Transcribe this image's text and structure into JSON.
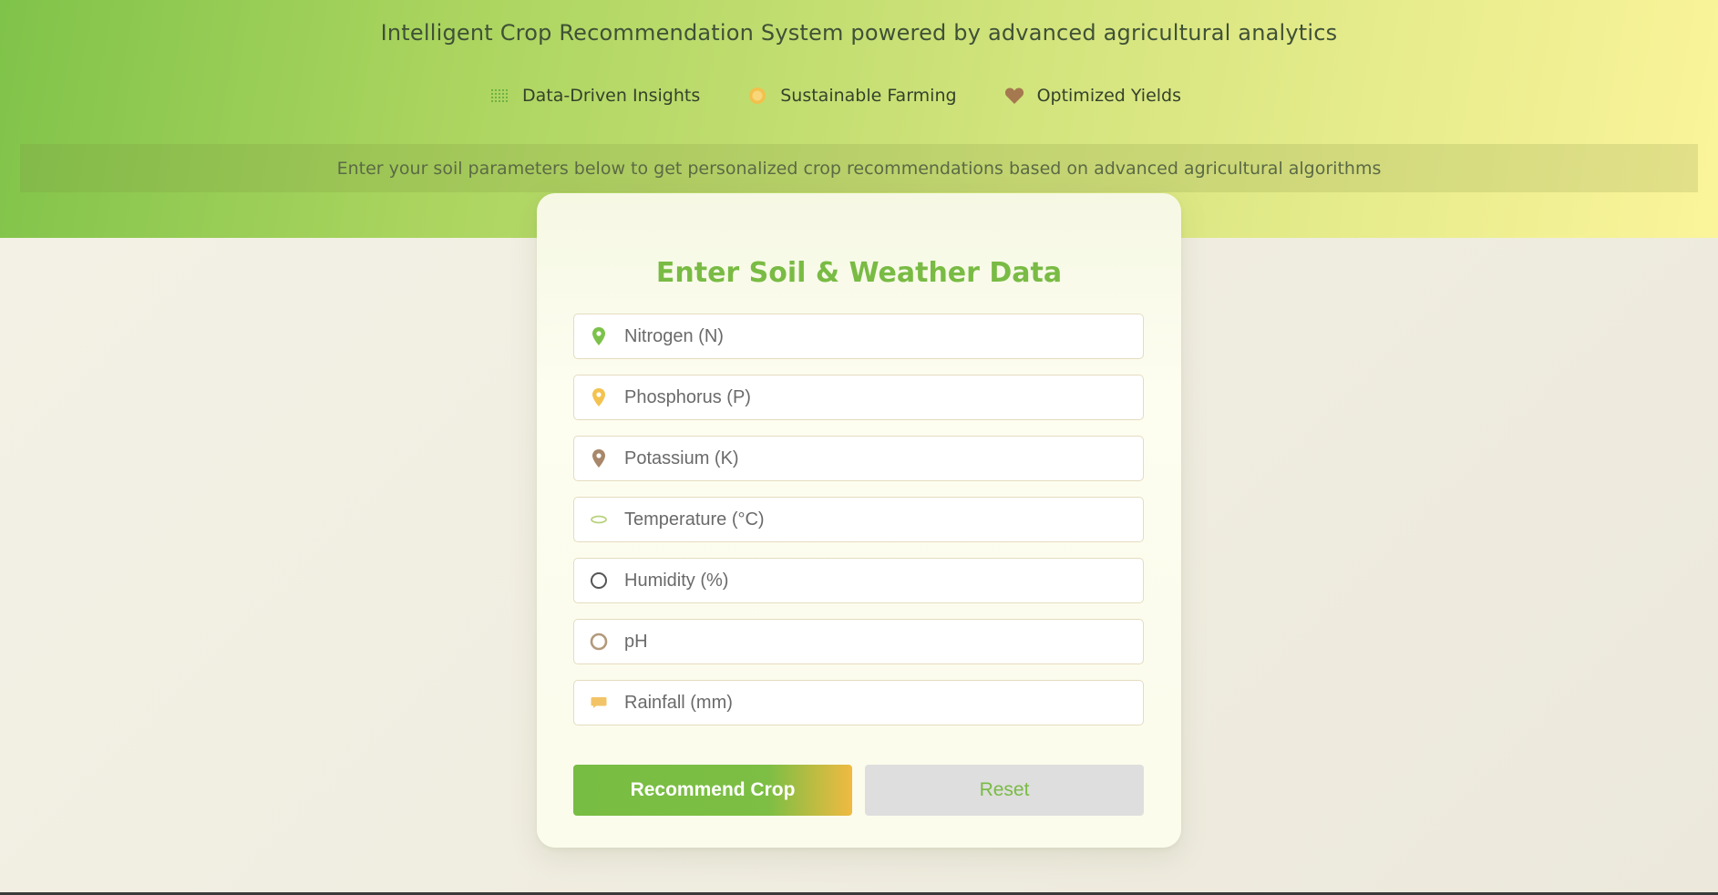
{
  "header": {
    "subtitle": "Intelligent Crop Recommendation System powered by advanced agricultural analytics",
    "features": [
      {
        "icon": "grid-dots-icon",
        "label": "Data-Driven Insights"
      },
      {
        "icon": "sun-icon",
        "label": "Sustainable Farming"
      },
      {
        "icon": "heart-icon",
        "label": "Optimized Yields"
      }
    ],
    "banner": "Enter your soil parameters below to get personalized crop recommendations based on advanced agricultural algorithms"
  },
  "form": {
    "title": "Enter Soil & Weather Data",
    "fields": [
      {
        "icon": "map-pin-icon",
        "placeholder": "Nitrogen (N)",
        "value": "",
        "color": "#7cc24a"
      },
      {
        "icon": "map-pin-icon",
        "placeholder": "Phosphorus (P)",
        "value": "",
        "color": "#f4c24f"
      },
      {
        "icon": "map-pin-icon",
        "placeholder": "Potassium (K)",
        "value": "",
        "color": "#a8876a"
      },
      {
        "icon": "thermometer-icon",
        "placeholder": "Temperature (°C)",
        "value": "",
        "color": "#b9d27d"
      },
      {
        "icon": "droplet-icon",
        "placeholder": "Humidity (%)",
        "value": "",
        "color": "#555555"
      },
      {
        "icon": "ph-icon",
        "placeholder": "pH",
        "value": "",
        "color": "#b39a7c"
      },
      {
        "icon": "cloud-rain-icon",
        "placeholder": "Rainfall (mm)",
        "value": "",
        "color": "#f2c467"
      }
    ],
    "buttons": {
      "recommend": "Recommend Crop",
      "reset": "Reset"
    }
  },
  "colors": {
    "accent": "#79bb44",
    "secondary_accent": "#f0ba41",
    "hero_start": "#80c34a",
    "hero_end": "#fbf49b"
  }
}
